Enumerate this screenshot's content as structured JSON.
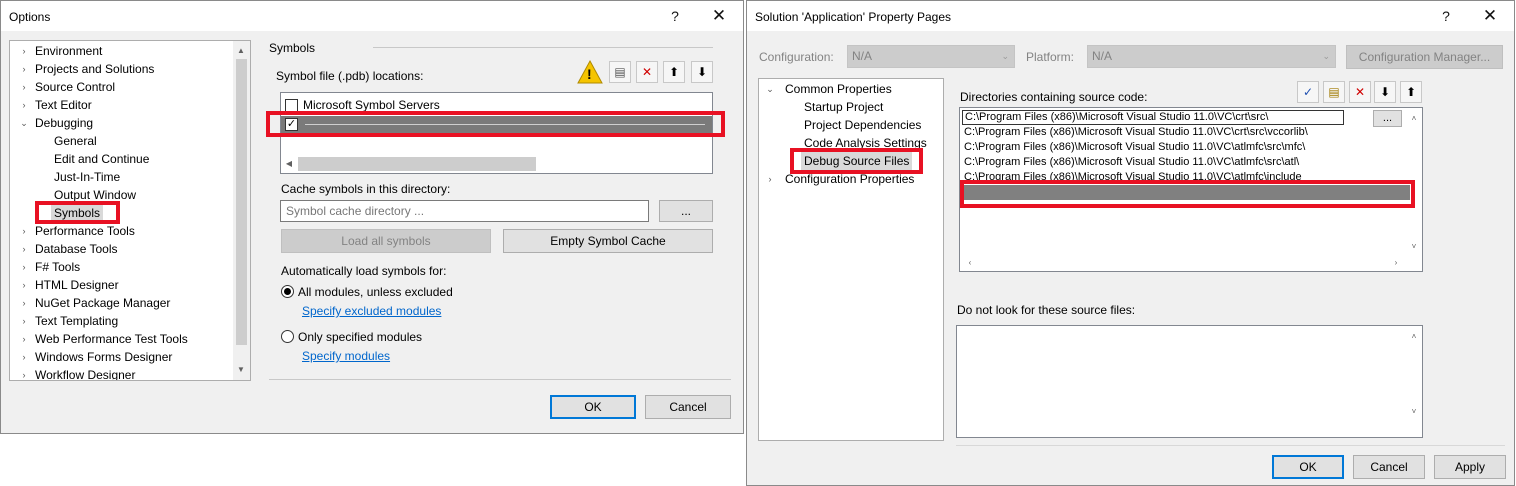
{
  "options_dialog": {
    "title": "Options",
    "help_btn": "?",
    "close_btn": "✕",
    "tree_items": [
      {
        "label": "Environment",
        "chevron": "›"
      },
      {
        "label": "Projects and Solutions",
        "chevron": "›"
      },
      {
        "label": "Source Control",
        "chevron": "›"
      },
      {
        "label": "Text Editor",
        "chevron": "›"
      },
      {
        "label": "Debugging",
        "chevron": "⌄"
      },
      {
        "label": "General",
        "chevron": ""
      },
      {
        "label": "Edit and Continue",
        "chevron": ""
      },
      {
        "label": "Just-In-Time",
        "chevron": ""
      },
      {
        "label": "Output Window",
        "chevron": ""
      },
      {
        "label": "Symbols",
        "chevron": ""
      },
      {
        "label": "Performance Tools",
        "chevron": "›"
      },
      {
        "label": "Database Tools",
        "chevron": "›"
      },
      {
        "label": "F# Tools",
        "chevron": "›"
      },
      {
        "label": "HTML Designer",
        "chevron": "›"
      },
      {
        "label": "NuGet Package Manager",
        "chevron": "›"
      },
      {
        "label": "Text Templating",
        "chevron": "›"
      },
      {
        "label": "Web Performance Test Tools",
        "chevron": "›"
      },
      {
        "label": "Windows Forms Designer",
        "chevron": "›"
      },
      {
        "label": "Workflow Designer",
        "chevron": "›"
      }
    ],
    "section_title": "Symbols",
    "symbol_locations_label": "Symbol file (.pdb) locations:",
    "toolbar_icons": {
      "warning": "!",
      "new_folder": "▤",
      "delete": "✕",
      "up": "⬆",
      "down": "⬇"
    },
    "symbol_list": [
      {
        "label": "Microsoft Symbol Servers",
        "checked": false
      },
      {
        "label": "",
        "checked": true
      }
    ],
    "cache_label": "Cache symbols in this directory:",
    "cache_placeholder": "Symbol cache directory ...",
    "browse_btn": "...",
    "load_all_btn": "Load all symbols",
    "empty_cache_btn": "Empty Symbol Cache",
    "auto_load_label": "Automatically load symbols for:",
    "radio_all": "All modules, unless excluded",
    "link_excluded": "Specify excluded modules",
    "radio_specified": "Only specified modules",
    "link_modules": "Specify modules",
    "ok_btn": "OK",
    "cancel_btn": "Cancel"
  },
  "props_dialog": {
    "title": "Solution 'Application' Property Pages",
    "help_btn": "?",
    "close_btn": "✕",
    "config_label": "Configuration:",
    "config_value": "N/A",
    "platform_label": "Platform:",
    "platform_value": "N/A",
    "config_manager_btn": "Configuration Manager...",
    "tree_items": [
      {
        "label": "Common Properties",
        "chevron": "⌄"
      },
      {
        "label": "Startup Project",
        "chevron": ""
      },
      {
        "label": "Project Dependencies",
        "chevron": ""
      },
      {
        "label": "Code Analysis Settings",
        "chevron": ""
      },
      {
        "label": "Debug Source Files",
        "chevron": ""
      },
      {
        "label": "Configuration Properties",
        "chevron": "›"
      }
    ],
    "dirs_label": "Directories containing source code:",
    "toolbar_icons": {
      "check": "✓",
      "new_folder": "▤",
      "delete": "✕",
      "down": "⬇",
      "up": "⬆"
    },
    "dirs": [
      "C:\\Program Files (x86)\\Microsoft Visual Studio 11.0\\VC\\crt\\src\\",
      "C:\\Program Files (x86)\\Microsoft Visual Studio 11.0\\VC\\crt\\src\\vccorlib\\",
      "C:\\Program Files (x86)\\Microsoft Visual Studio 11.0\\VC\\atlmfc\\src\\mfc\\",
      "C:\\Program Files (x86)\\Microsoft Visual Studio 11.0\\VC\\atlmfc\\src\\atl\\",
      "C:\\Program Files (x86)\\Microsoft Visual Studio 11.0\\VC\\atlmfc\\include"
    ],
    "browse_btn": "...",
    "exclude_label": "Do not look for these source files:",
    "ok_btn": "OK",
    "cancel_btn": "Cancel",
    "apply_btn": "Apply"
  }
}
